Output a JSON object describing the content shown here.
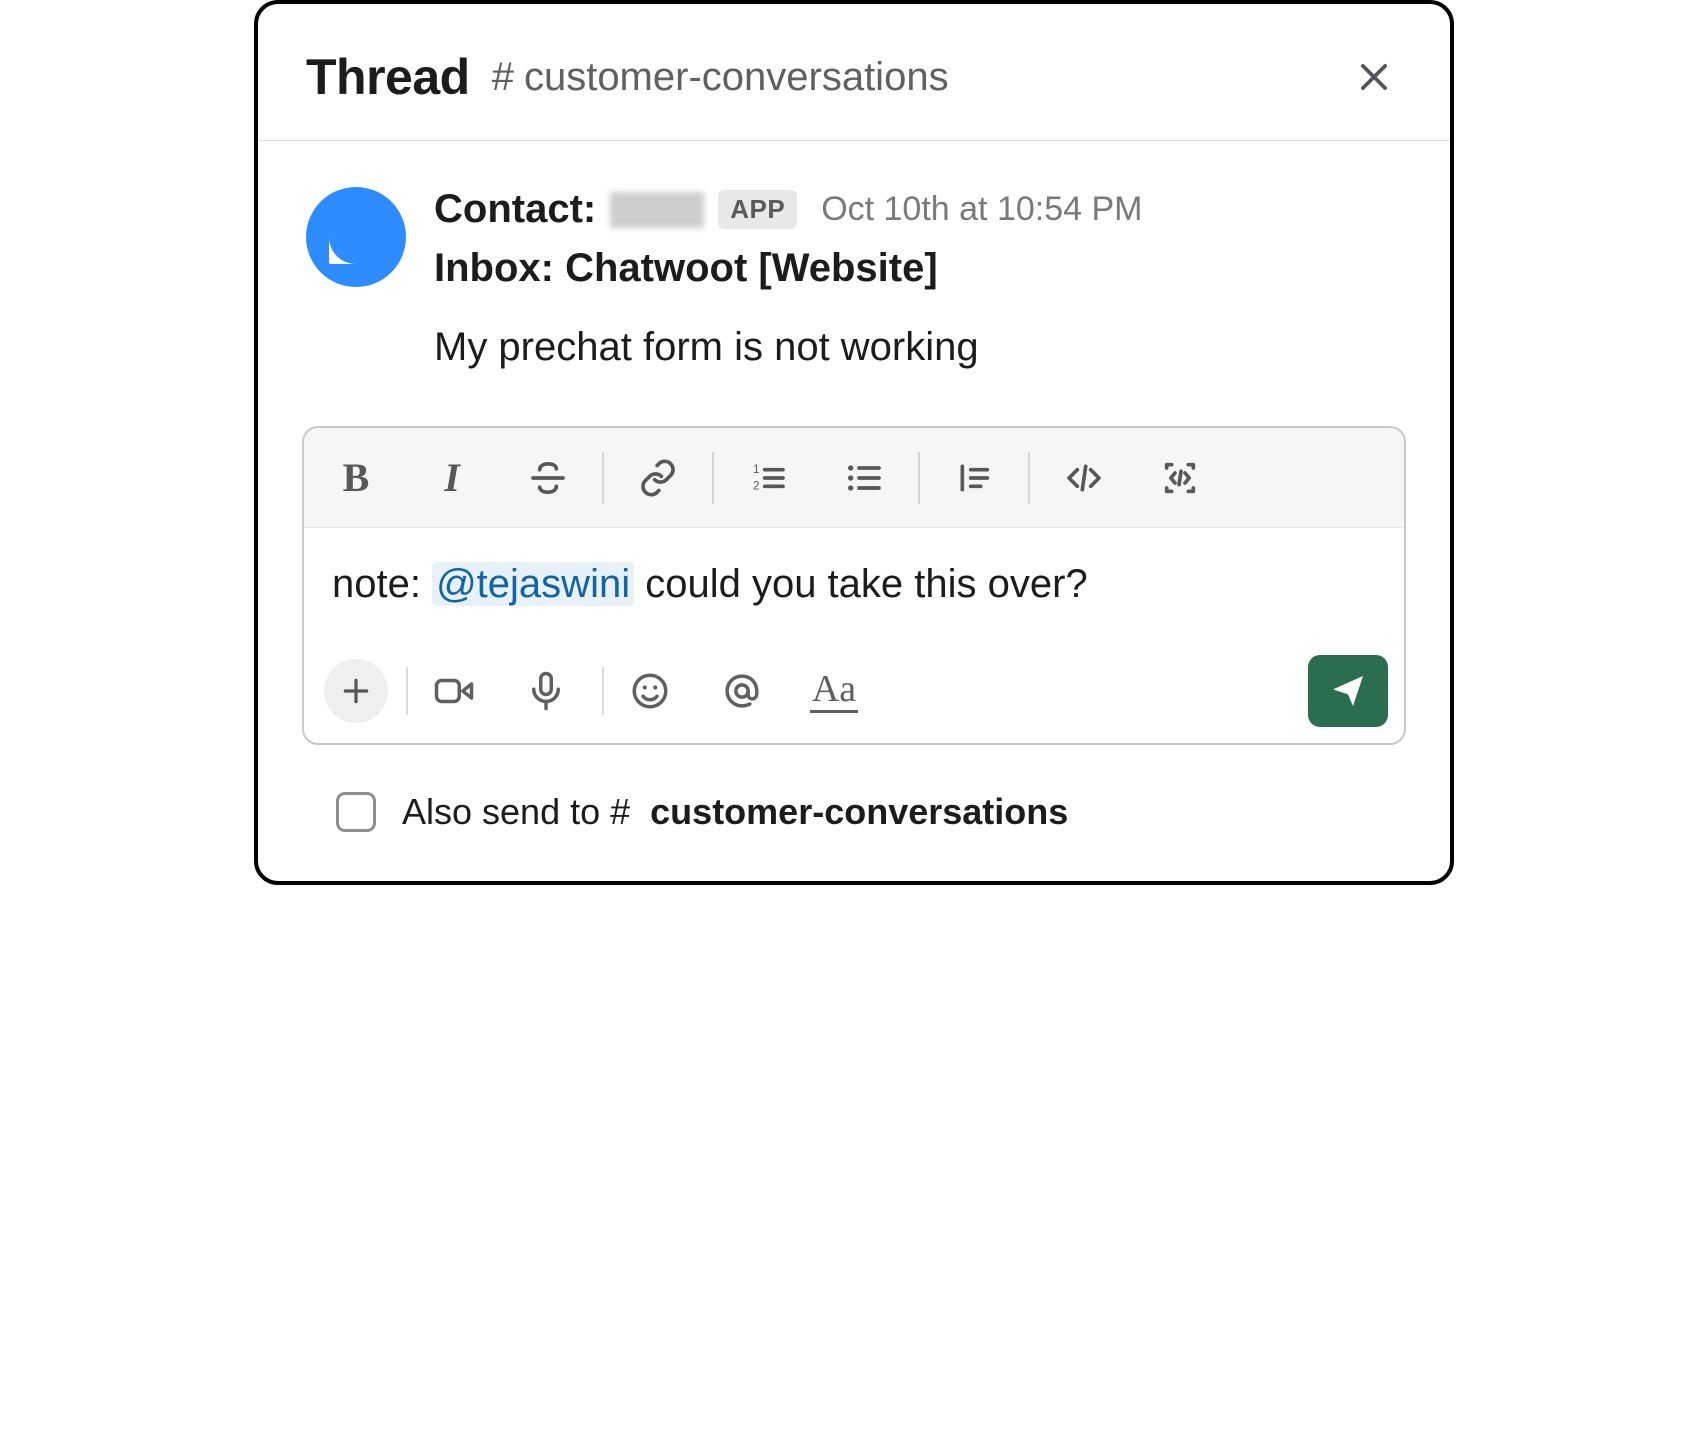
{
  "header": {
    "title": "Thread",
    "channel": "customer-conversations"
  },
  "message": {
    "contact_label": "Contact:",
    "app_badge": "APP",
    "timestamp": "Oct 10th at 10:54 PM",
    "inbox_line": "Inbox: Chatwoot [Website]",
    "text": "My prechat form is not working"
  },
  "composer": {
    "note_prefix": "note: ",
    "mention": "@tejaswini",
    "trailing": " could you take this over?"
  },
  "also_send": {
    "label": "Also send to ",
    "channel": "customer-conversations",
    "checked": false
  },
  "icons": {
    "bold": "B",
    "italic": "I"
  }
}
